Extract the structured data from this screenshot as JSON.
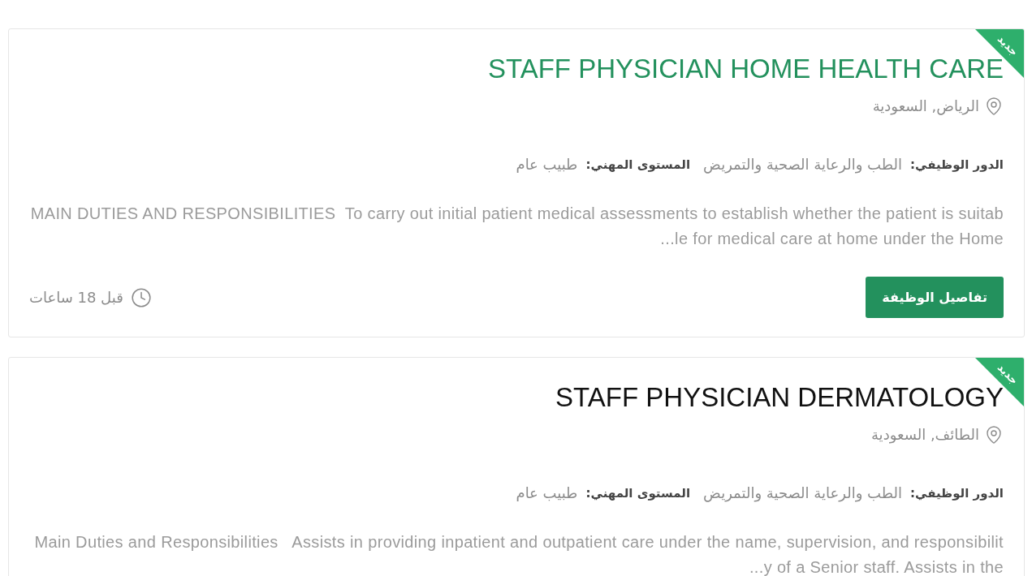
{
  "jobs": [
    {
      "badge": "جديد",
      "title": "STAFF PHYSICIAN HOME HEALTH CARE",
      "hovered": true,
      "location": "الرياض, السعودية",
      "meta": [
        {
          "label": "الدور الوظيفي:",
          "value": "الطب والرعاية الصحية والتمريض"
        },
        {
          "label": "المستوى المهني:",
          "value": "طبيب عام"
        }
      ],
      "description": "MAIN DUTIES AND RESPONSIBILITIES  To carry out initial patient medical assessments to establish whether the patient is suitable for medical care at home under the Home...",
      "button": "تفاصيل الوظيفة",
      "posted": "قبل 18 ساعات"
    },
    {
      "badge": "جديد",
      "title": "STAFF PHYSICIAN DERMATOLOGY",
      "hovered": false,
      "location": "الطائف, السعودية",
      "meta": [
        {
          "label": "الدور الوظيفي:",
          "value": "الطب والرعاية الصحية والتمريض"
        },
        {
          "label": "المستوى المهني:",
          "value": "طبيب عام"
        }
      ],
      "description": "Main Duties and Responsibilities   Assists in providing inpatient and outpatient care under the name, supervision, and responsibility of a Senior staff. Assists in the..."
    }
  ]
}
